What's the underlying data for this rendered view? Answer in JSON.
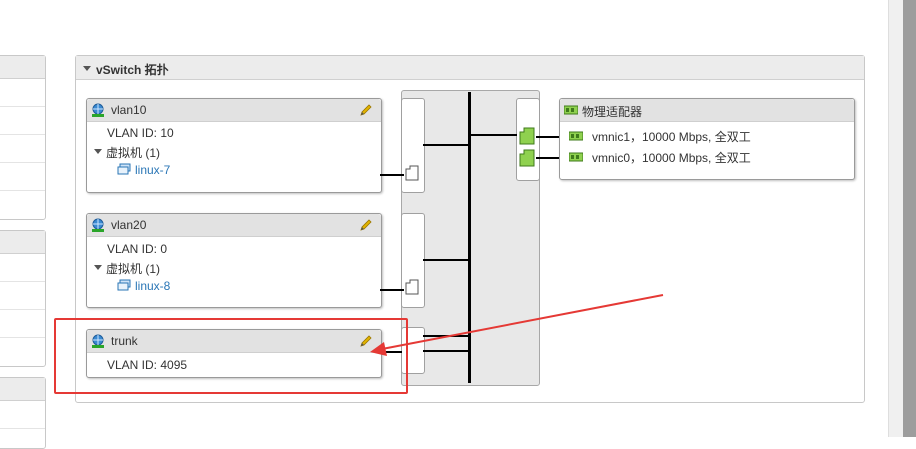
{
  "panel": {
    "title": "vSwitch 拓扑"
  },
  "port_groups": [
    {
      "name": "vlan10",
      "vlan_id": "VLAN ID: 10",
      "vm_section": "虚拟机 (1)",
      "vm": "linux-7"
    },
    {
      "name": "vlan20",
      "vlan_id": "VLAN ID: 0",
      "vm_section": "虚拟机 (1)",
      "vm": "linux-8"
    },
    {
      "name": "trunk",
      "vlan_id": "VLAN ID: 4095"
    }
  ],
  "physical_adapters": {
    "title": "物理适配器",
    "items": [
      {
        "label": "vmnic1，10000 Mbps, 全双工"
      },
      {
        "label": "vmnic0，10000 Mbps, 全双工"
      }
    ]
  },
  "annotation": {
    "highlight_color": "#e53935"
  },
  "colors": {
    "link": "#2a76b6",
    "nic_green": "#8fd14f",
    "edit_pencil": "#d9a400"
  },
  "icons": [
    "network-globe-icon",
    "edit-pencil-icon",
    "vm-icon",
    "nic-icon",
    "port-connector-icon",
    "caret-down-icon"
  ]
}
